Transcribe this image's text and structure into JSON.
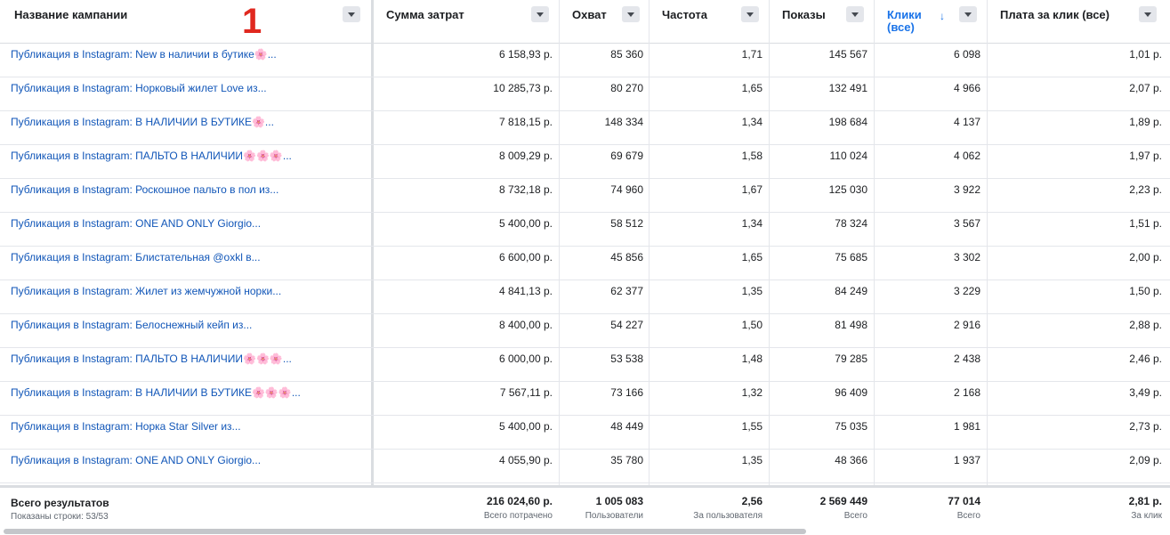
{
  "badge": "1",
  "columns": {
    "name": "Название кампании",
    "spend": "Сумма затрат",
    "reach": "Охват",
    "frequency": "Частота",
    "impressions": "Показы",
    "clicks_line1": "Клики",
    "clicks_line2": "(все)",
    "clicks_sort_arrow": "↓",
    "cpc": "Плата за клик (все)"
  },
  "rows": [
    {
      "name": "Публикация в Instagram: New в наличии в бутике🌸...",
      "spend": "6 158,93 р.",
      "reach": "85 360",
      "frequency": "1,71",
      "impressions": "145 567",
      "clicks": "6 098",
      "cpc": "1,01 р."
    },
    {
      "name": "Публикация в Instagram: Норковый жилет Love из...",
      "spend": "10 285,73 р.",
      "reach": "80 270",
      "frequency": "1,65",
      "impressions": "132 491",
      "clicks": "4 966",
      "cpc": "2,07 р."
    },
    {
      "name": "Публикация в Instagram: В НАЛИЧИИ В БУТИКЕ🌸...",
      "spend": "7 818,15 р.",
      "reach": "148 334",
      "frequency": "1,34",
      "impressions": "198 684",
      "clicks": "4 137",
      "cpc": "1,89 р."
    },
    {
      "name": "Публикация в Instagram: ПАЛЬТО В НАЛИЧИИ🌸🌸🌸...",
      "spend": "8 009,29 р.",
      "reach": "69 679",
      "frequency": "1,58",
      "impressions": "110 024",
      "clicks": "4 062",
      "cpc": "1,97 р."
    },
    {
      "name": "Публикация в Instagram: Роскошное пальто в пол из...",
      "spend": "8 732,18 р.",
      "reach": "74 960",
      "frequency": "1,67",
      "impressions": "125 030",
      "clicks": "3 922",
      "cpc": "2,23 р."
    },
    {
      "name": "Публикация в Instagram: ONE AND ONLY Giorgio...",
      "spend": "5 400,00 р.",
      "reach": "58 512",
      "frequency": "1,34",
      "impressions": "78 324",
      "clicks": "3 567",
      "cpc": "1,51 р."
    },
    {
      "name": "Публикация в Instagram: Блистательная @oxkl в...",
      "spend": "6 600,00 р.",
      "reach": "45 856",
      "frequency": "1,65",
      "impressions": "75 685",
      "clicks": "3 302",
      "cpc": "2,00 р."
    },
    {
      "name": "Публикация в Instagram: Жилет из жемчужной норки...",
      "spend": "4 841,13 р.",
      "reach": "62 377",
      "frequency": "1,35",
      "impressions": "84 249",
      "clicks": "3 229",
      "cpc": "1,50 р."
    },
    {
      "name": "Публикация в Instagram: Белоснежный кейп из...",
      "spend": "8 400,00 р.",
      "reach": "54 227",
      "frequency": "1,50",
      "impressions": "81 498",
      "clicks": "2 916",
      "cpc": "2,88 р."
    },
    {
      "name": "Публикация в Instagram: ПАЛЬТО В НАЛИЧИИ🌸🌸🌸...",
      "spend": "6 000,00 р.",
      "reach": "53 538",
      "frequency": "1,48",
      "impressions": "79 285",
      "clicks": "2 438",
      "cpc": "2,46 р."
    },
    {
      "name": "Публикация в Instagram: В НАЛИЧИИ В БУТИКЕ🌸🌸🌸...",
      "spend": "7 567,11 р.",
      "reach": "73 166",
      "frequency": "1,32",
      "impressions": "96 409",
      "clicks": "2 168",
      "cpc": "3,49 р."
    },
    {
      "name": "Публикация в Instagram: Норка Star Silver из...",
      "spend": "5 400,00 р.",
      "reach": "48 449",
      "frequency": "1,55",
      "impressions": "75 035",
      "clicks": "1 981",
      "cpc": "2,73 р."
    },
    {
      "name": "Публикация в Instagram: ONE AND ONLY Giorgio...",
      "spend": "4 055,90 р.",
      "reach": "35 780",
      "frequency": "1,35",
      "impressions": "48 366",
      "clicks": "1 937",
      "cpc": "2,09 р."
    }
  ],
  "totals": {
    "title": "Всего результатов",
    "subtitle": "Показаны строки: 53/53",
    "spend": "216 024,60 р.",
    "spend_label": "Всего потрачено",
    "reach": "1 005 083",
    "reach_label": "Пользователи",
    "frequency": "2,56",
    "frequency_label": "За пользователя",
    "impressions": "2 569 449",
    "impressions_label": "Всего",
    "clicks": "77 014",
    "clicks_label": "Всего",
    "cpc": "2,81 р.",
    "cpc_label": "За клик"
  },
  "colors": {
    "link": "#1156b8",
    "sorted_header": "#1a73e8",
    "badge": "#e0281f"
  }
}
